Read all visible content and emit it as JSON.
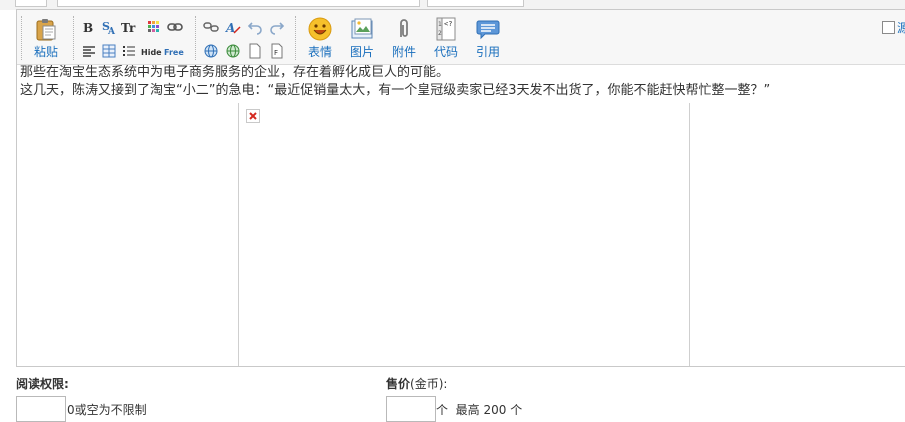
{
  "toolbar": {
    "paste_label": "粘贴",
    "emoticon_label": "表情",
    "image_label": "图片",
    "attachment_label": "附件",
    "code_label": "代码",
    "quote_label": "引用",
    "bold_glyph": "B",
    "title_glyph": "Tr",
    "hide_glyph": "Hide",
    "free_glyph": "Free",
    "code_glyph_top": "<?",
    "code_glyph_num1": "1",
    "code_glyph_num2": "2",
    "checkbox_label": "源"
  },
  "editor": {
    "line1": "那些在淘宝生态系统中为电子商务服务的企业，存在着孵化成巨人的可能。",
    "line2": "这几天，陈涛又接到了淘宝“小二”的急电：“最近促销量太大，有一个皇冠级卖家已经3天发不出货了，你能不能赶快帮忙整一整？”",
    "broken_image_mark": "✕"
  },
  "permission": {
    "label": "阅读权限:",
    "hint": "0或空为不限制",
    "value": ""
  },
  "price": {
    "label_bold": "售价",
    "label_unit": "(金币):",
    "unit": "个",
    "max_text": "最高  200 个",
    "value": ""
  },
  "colors": {
    "accent": "#1a6fbd",
    "border": "#c9c9c9",
    "toolbar_bg": "#f7f7f7",
    "error_red": "#d4281f"
  }
}
